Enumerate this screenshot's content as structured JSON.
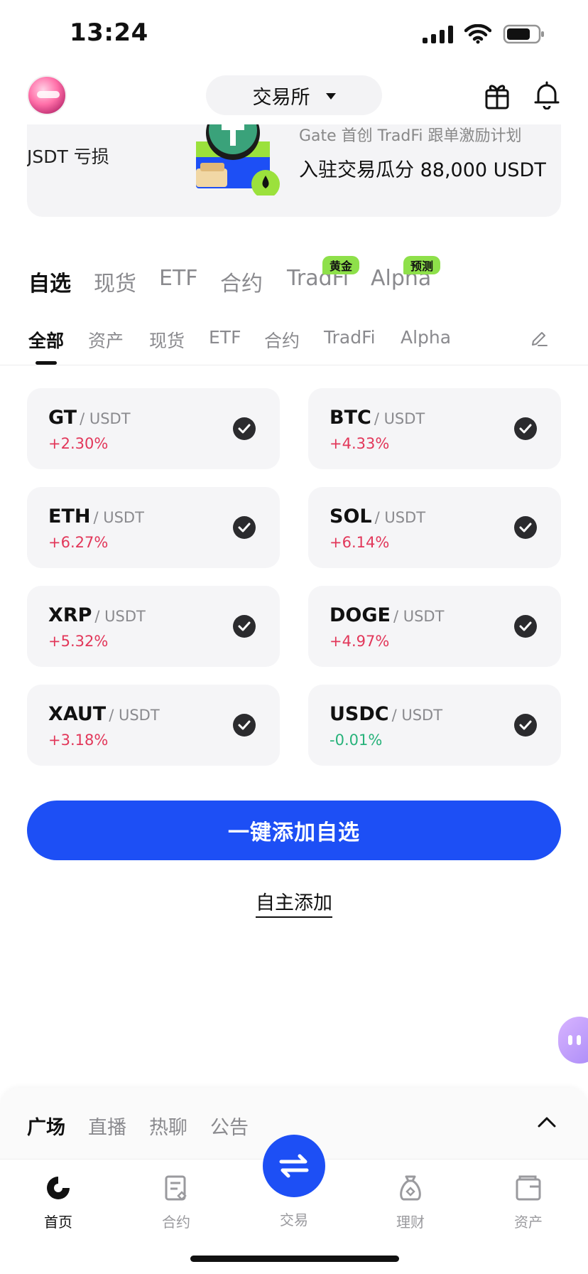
{
  "status_bar": {
    "time": "13:24"
  },
  "header": {
    "exchange_label": "交易所"
  },
  "banner": {
    "left_text": "JSDT 亏损",
    "subtitle": "Gate 首创 TradFi 跟单激励计划",
    "title": "入驻交易瓜分 88,000 USDT"
  },
  "category_tabs": [
    {
      "label": "自选",
      "active": true
    },
    {
      "label": "现货"
    },
    {
      "label": "ETF"
    },
    {
      "label": "合约"
    },
    {
      "label": "TradFi",
      "badge": "黄金"
    },
    {
      "label": "Alpha",
      "badge": "预测"
    }
  ],
  "sub_tabs": [
    {
      "label": "全部",
      "active": true
    },
    {
      "label": "资产"
    },
    {
      "label": "现货"
    },
    {
      "label": "ETF"
    },
    {
      "label": "合约"
    },
    {
      "label": "TradFi"
    },
    {
      "label": "Alpha"
    }
  ],
  "pairs": [
    {
      "base": "GT",
      "quote": "/ USDT",
      "change": "+2.30%",
      "direction": "up"
    },
    {
      "base": "BTC",
      "quote": "/ USDT",
      "change": "+4.33%",
      "direction": "up"
    },
    {
      "base": "ETH",
      "quote": "/ USDT",
      "change": "+6.27%",
      "direction": "up"
    },
    {
      "base": "SOL",
      "quote": "/ USDT",
      "change": "+6.14%",
      "direction": "up"
    },
    {
      "base": "XRP",
      "quote": "/ USDT",
      "change": "+5.32%",
      "direction": "up"
    },
    {
      "base": "DOGE",
      "quote": "/ USDT",
      "change": "+4.97%",
      "direction": "up"
    },
    {
      "base": "XAUT",
      "quote": "/ USDT",
      "change": "+3.18%",
      "direction": "up"
    },
    {
      "base": "USDC",
      "quote": "/ USDT",
      "change": "-0.01%",
      "direction": "down"
    }
  ],
  "actions": {
    "add_all": "一键添加自选",
    "manual_add": "自主添加"
  },
  "social_tabs": [
    {
      "label": "广场",
      "active": true
    },
    {
      "label": "直播"
    },
    {
      "label": "热聊"
    },
    {
      "label": "公告"
    }
  ],
  "bottom_nav": {
    "home": "首页",
    "futures": "合约",
    "trade": "交易",
    "earn": "理财",
    "assets": "资产"
  },
  "colors": {
    "accent": "#1d4ff5",
    "up": "#e2375a",
    "down": "#27b27a",
    "badge": "#8ee04a"
  }
}
